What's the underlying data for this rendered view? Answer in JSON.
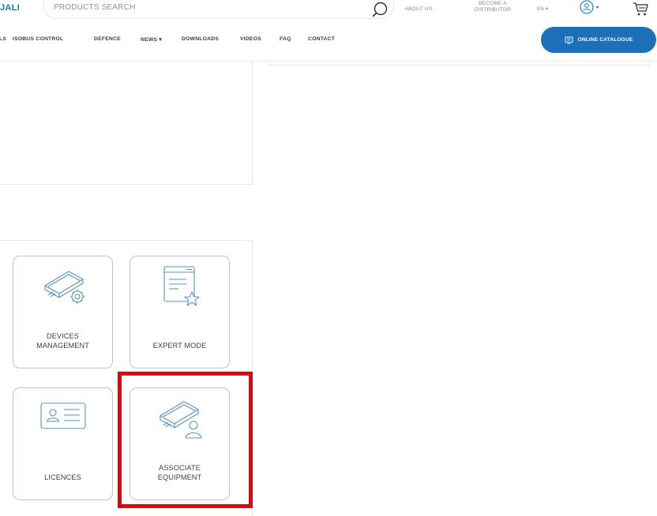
{
  "header": {
    "brand": "JALI",
    "search_placeholder": "PRODUCTS SEARCH",
    "about_us": "ABOUT US",
    "become_distributor": "BECOME A\nDISTRIBUTOR",
    "language": "EN ▾",
    "user_menu_caret": "▾"
  },
  "nav": {
    "items": [
      "LS",
      "ISOBUS CONTROL",
      "DEFENCE",
      "NEWS ▾",
      "DOWNLOADS",
      "VIDEOS",
      "FAQ",
      "CONTACT"
    ],
    "catalogue_label": "ONLINE CATALOGUE"
  },
  "tiles": [
    {
      "label": "DEVICES\nMANAGEMENT",
      "icon": "device-gear-icon"
    },
    {
      "label": "EXPERT MODE",
      "icon": "document-star-icon"
    },
    {
      "label": "LICENCES",
      "icon": "id-card-icon"
    },
    {
      "label": "ASSOCIATE\nEQUIPMENT",
      "icon": "device-user-icon"
    }
  ],
  "colors": {
    "accent": "#1d70b8",
    "icon_stroke": "#5a93c4",
    "highlight": "#e8000b"
  }
}
